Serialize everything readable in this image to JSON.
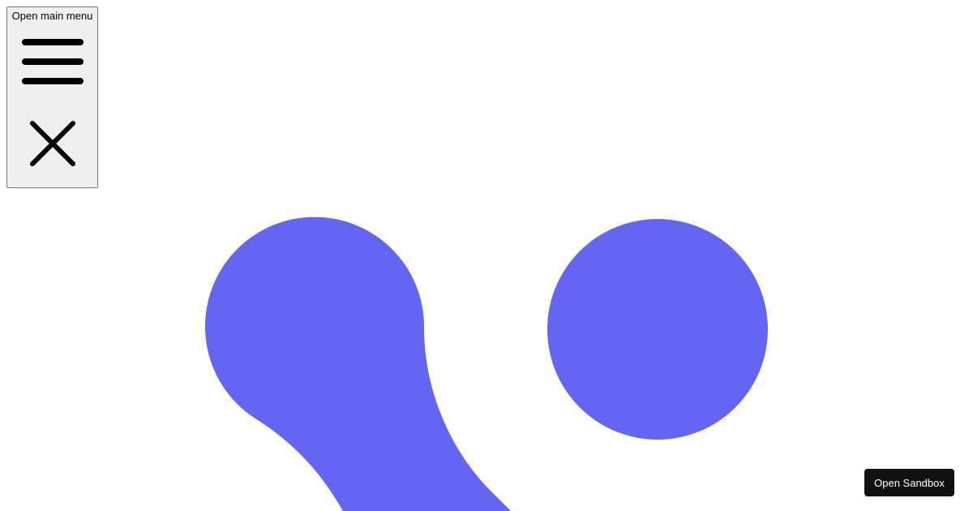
{
  "menu_button": {
    "label": "Open main menu",
    "icons": [
      "hamburger-menu-icon",
      "close-icon"
    ]
  },
  "logo": {
    "color": "#6366f1",
    "icon": "brand-logo-icon"
  },
  "sandbox_button": {
    "label": "Open Sandbox",
    "background": "#111111",
    "text_color": "#ffffff"
  }
}
